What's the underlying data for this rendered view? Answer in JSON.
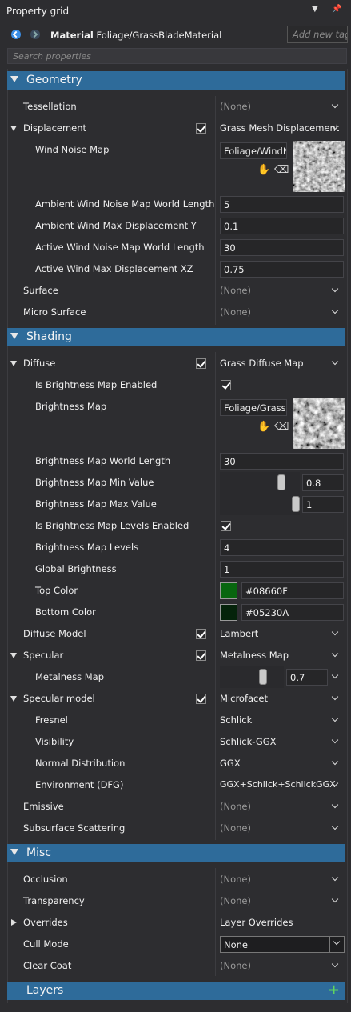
{
  "panel": {
    "title": "Property grid"
  },
  "header": {
    "type_label": "Material",
    "asset_path": "Foliage/GrassBladeMaterial",
    "tag_placeholder": "Add new tag",
    "search_placeholder": "Search properties"
  },
  "sections": {
    "geometry": "Geometry",
    "shading": "Shading",
    "misc": "Misc",
    "layers": "Layers"
  },
  "geometry": {
    "tessellation": {
      "label": "Tessellation",
      "value": "(None)"
    },
    "displacement": {
      "label": "Displacement",
      "enabled": true,
      "value": "Grass Mesh Displacement"
    },
    "wind_noise_map": {
      "label": "Wind Noise Map",
      "asset": "Foliage/WindNoise"
    },
    "ambient_world_length": {
      "label": "Ambient Wind Noise Map World Length",
      "value": "5"
    },
    "ambient_max_disp": {
      "label": "Ambient Wind Max Displacement Y",
      "value": "0.1"
    },
    "active_world_length": {
      "label": "Active Wind Noise Map World Length",
      "value": "30"
    },
    "active_max_disp": {
      "label": "Active Wind Max Displacement XZ",
      "value": "0.75"
    },
    "surface": {
      "label": "Surface",
      "value": "(None)"
    },
    "micro_surface": {
      "label": "Micro Surface",
      "value": "(None)"
    }
  },
  "shading": {
    "diffuse": {
      "label": "Diffuse",
      "enabled": true,
      "value": "Grass Diffuse Map"
    },
    "is_brightness_enabled": {
      "label": "Is Brightness Map Enabled",
      "checked": true
    },
    "brightness_map": {
      "label": "Brightness Map",
      "asset": "Foliage/GrassBrightness"
    },
    "brightness_world_length": {
      "label": "Brightness Map World Length",
      "value": "30"
    },
    "brightness_min": {
      "label": "Brightness Map Min Value",
      "value": "0.8",
      "slider_level": 0.8
    },
    "brightness_max": {
      "label": "Brightness Map Max Value",
      "value": "1",
      "slider_level": 1.0
    },
    "levels_enabled": {
      "label": "Is Brightness Map Levels Enabled",
      "checked": true
    },
    "levels": {
      "label": "Brightness Map Levels",
      "value": "4"
    },
    "global_brightness": {
      "label": "Global Brightness",
      "value": "1"
    },
    "top_color": {
      "label": "Top Color",
      "value": "#08660F",
      "swatch": "#08660F"
    },
    "bottom_color": {
      "label": "Bottom Color",
      "value": "#05230A",
      "swatch": "#05230A"
    },
    "diffuse_model": {
      "label": "Diffuse Model",
      "enabled": true,
      "value": "Lambert"
    },
    "specular": {
      "label": "Specular",
      "enabled": true,
      "value": "Metalness Map"
    },
    "metalness_map": {
      "label": "Metalness Map",
      "value": "0.7",
      "slider_level": 0.7
    },
    "specular_model": {
      "label": "Specular model",
      "enabled": true,
      "value": "Microfacet"
    },
    "fresnel": {
      "label": "Fresnel",
      "value": "Schlick"
    },
    "visibility": {
      "label": "Visibility",
      "value": "Schlick-GGX"
    },
    "normal_distribution": {
      "label": "Normal Distribution",
      "value": "GGX"
    },
    "environment_dfg": {
      "label": "Environment (DFG)",
      "value": "GGX+Schlick+SchlickGGX"
    },
    "emissive": {
      "label": "Emissive",
      "value": "(None)"
    },
    "subsurface": {
      "label": "Subsurface Scattering",
      "value": "(None)"
    }
  },
  "misc": {
    "occlusion": {
      "label": "Occlusion",
      "value": "(None)"
    },
    "transparency": {
      "label": "Transparency",
      "value": "(None)"
    },
    "overrides": {
      "label": "Overrides",
      "value": "Layer Overrides"
    },
    "cull_mode": {
      "label": "Cull Mode",
      "value": "None"
    },
    "clear_coat": {
      "label": "Clear Coat",
      "value": "(None)"
    }
  },
  "colors": {
    "section_header": "#2E6B9A",
    "panel_background": "#2D2D30",
    "accent_blue": "#3A8EE6",
    "add_green": "#5FD45F"
  }
}
